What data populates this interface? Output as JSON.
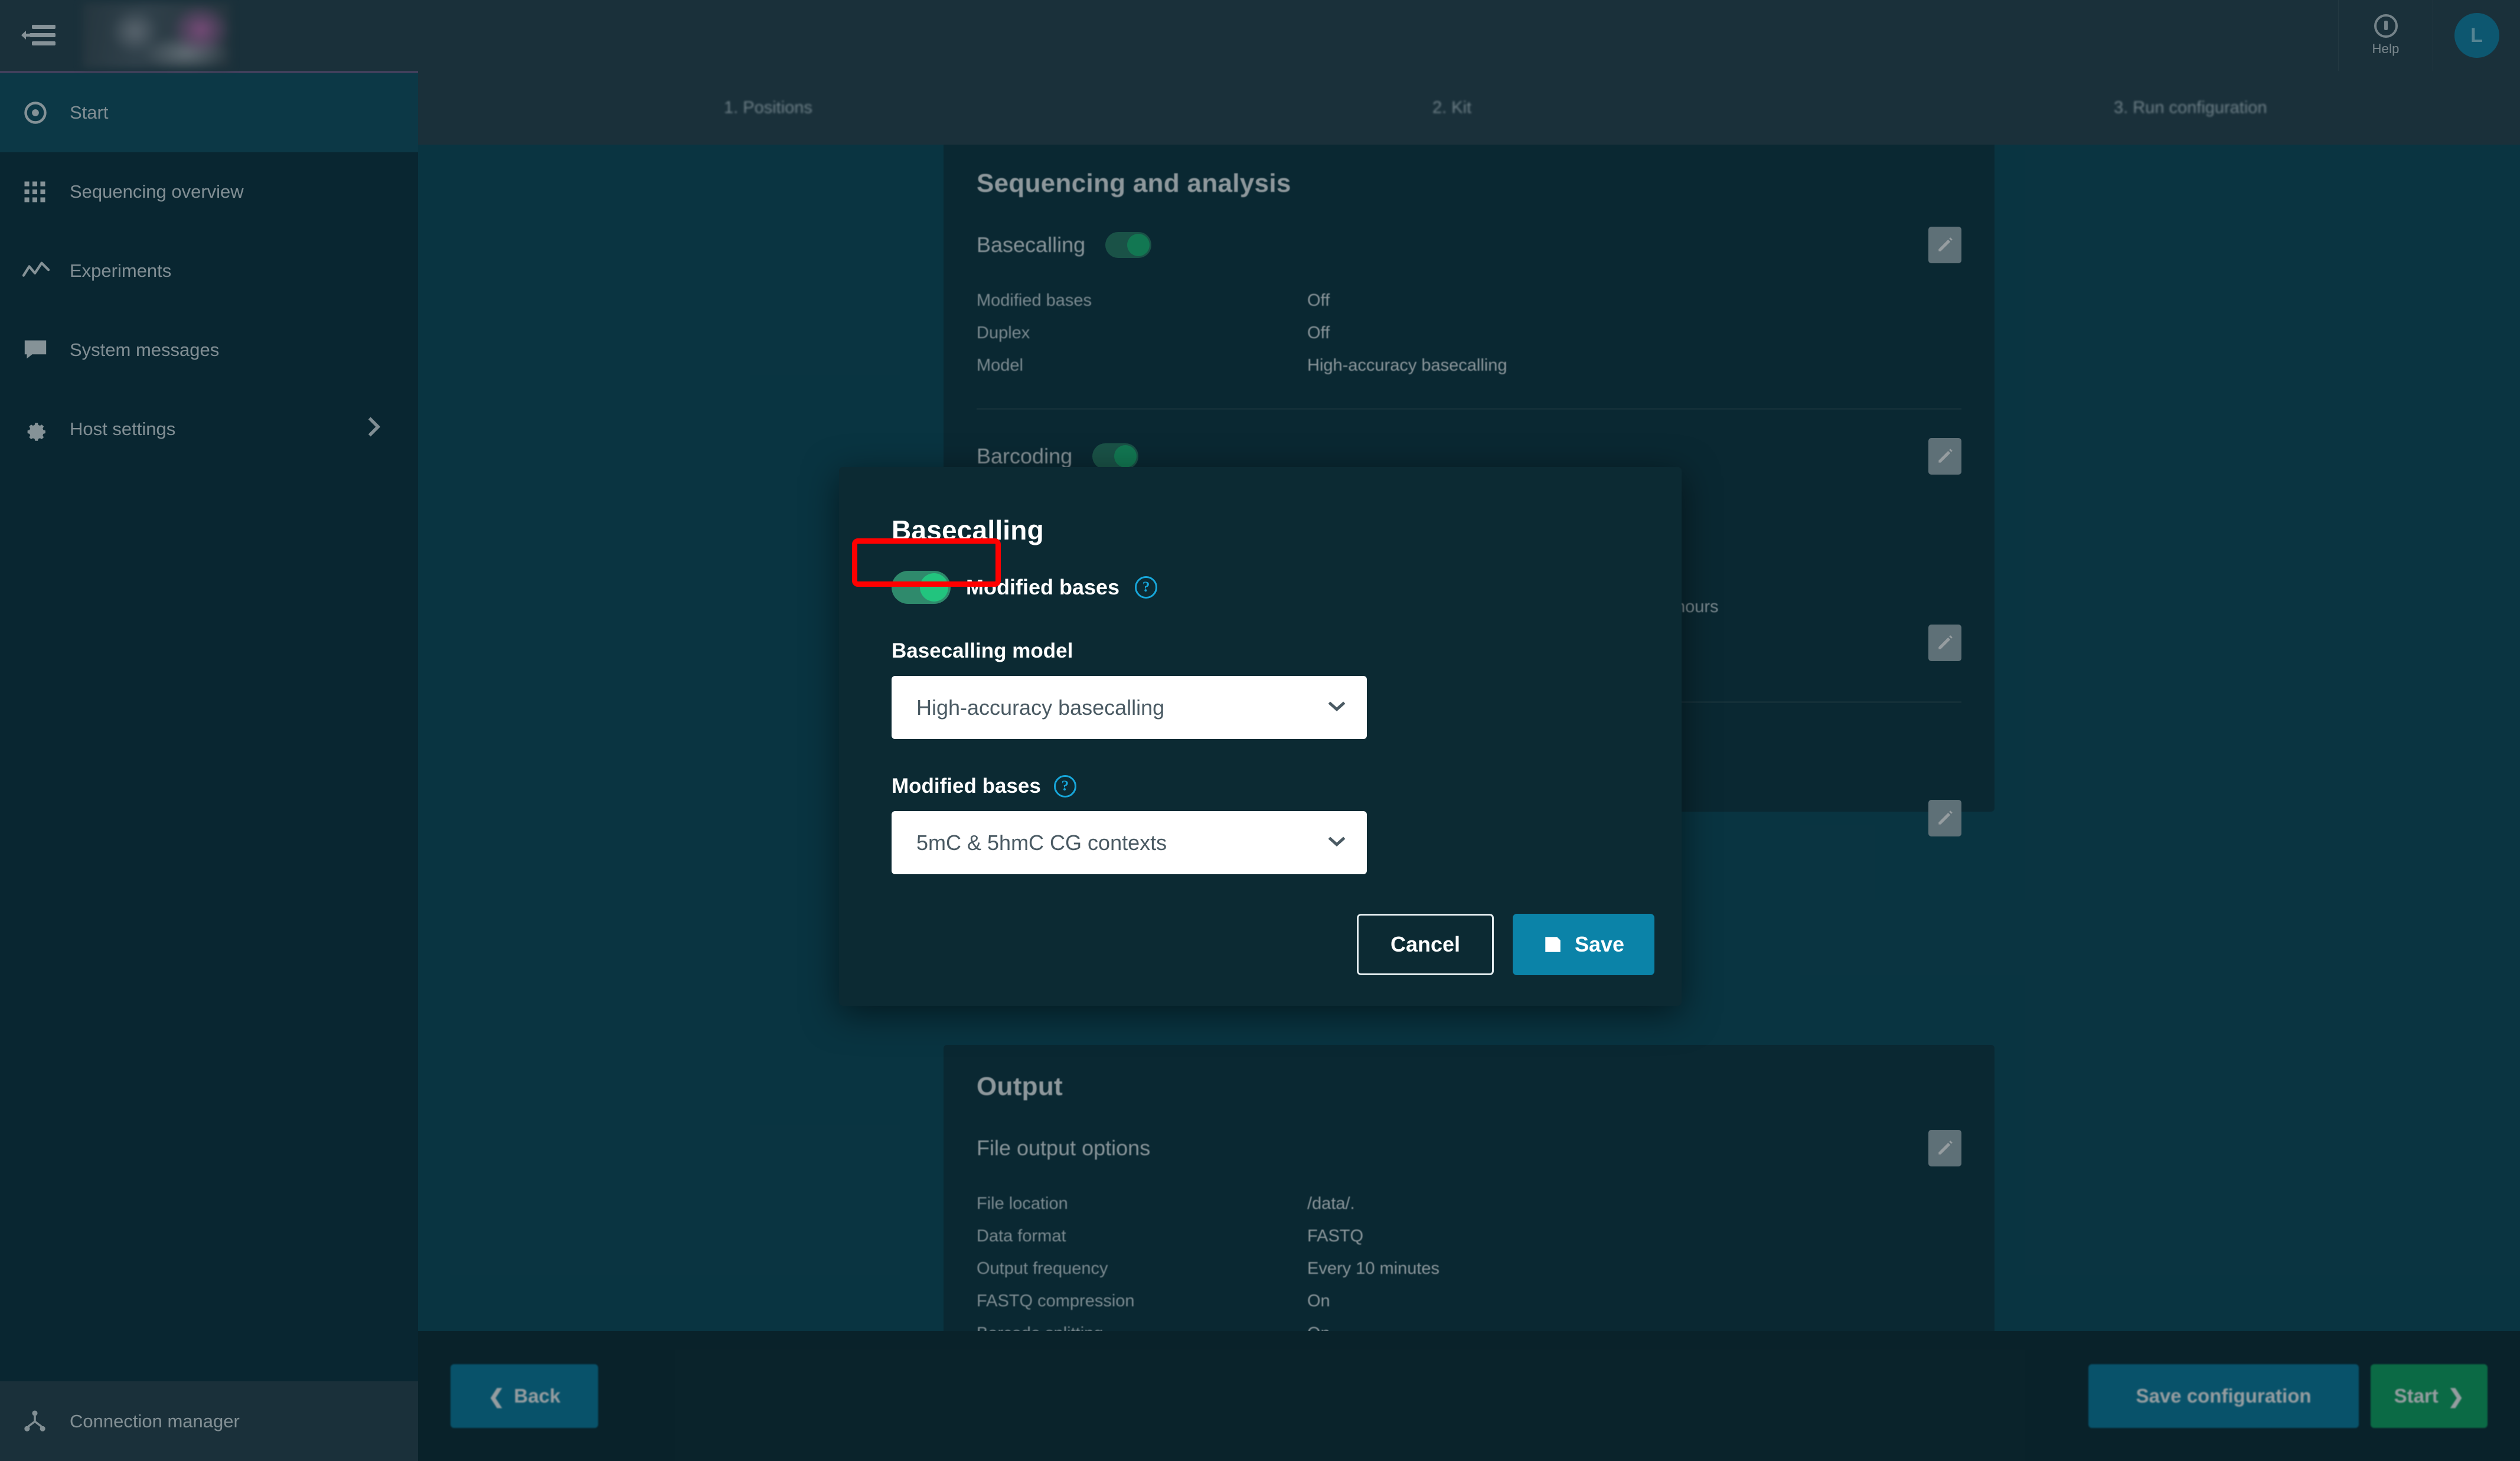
{
  "topbar": {
    "collapse_icon": "collapse-menu-icon",
    "logo_alt": "blurred-product-logo",
    "help_label": "Help",
    "help_icon": "help-circle-icon",
    "avatar_initial": "L"
  },
  "sidebar": {
    "items": [
      {
        "label": "Start",
        "icon": "target-icon",
        "active": true
      },
      {
        "label": "Sequencing overview",
        "icon": "grid-icon",
        "active": false
      },
      {
        "label": "Experiments",
        "icon": "activity-line-icon",
        "active": false
      },
      {
        "label": "System messages",
        "icon": "message-icon",
        "active": false
      },
      {
        "label": "Host settings",
        "icon": "gear-icon",
        "active": false,
        "has_chevron": true
      }
    ],
    "footer": {
      "label": "Connection manager",
      "icon": "network-node-icon"
    }
  },
  "steps": [
    {
      "label": "1. Positions"
    },
    {
      "label": "2. Kit"
    },
    {
      "label": "3. Run configuration"
    }
  ],
  "main": {
    "sequencing_panel": {
      "title": "Sequencing and analysis",
      "basecalling": {
        "label": "Basecalling",
        "toggle_on": true,
        "rows": [
          {
            "key": "Modified bases",
            "value": "Off"
          },
          {
            "key": "Duplex",
            "value": "Off"
          },
          {
            "key": "Model",
            "value": "High-accuracy basecalling"
          }
        ]
      },
      "barcoding": {
        "label": "Barcoding",
        "toggle_on": true
      },
      "hours_note": "hours"
    },
    "output_panel": {
      "title": "Output",
      "subtitle": "File output options",
      "rows": [
        {
          "key": "File location",
          "value": "/data/."
        },
        {
          "key": "Data format",
          "value": "FASTQ"
        },
        {
          "key": "Output frequency",
          "value": "Every 10 minutes"
        },
        {
          "key": "FASTQ compression",
          "value": "On"
        },
        {
          "key": "Barcode splitting",
          "value": "On"
        }
      ]
    }
  },
  "modal": {
    "title": "Basecalling",
    "modified_bases_toggle": {
      "label": "Modified bases",
      "on": true,
      "help_icon": "question-mark-icon",
      "highlighted": true
    },
    "basecalling_model": {
      "label": "Basecalling model",
      "value": "High-accuracy basecalling",
      "caret_icon": "chevron-down-icon"
    },
    "modified_bases_select": {
      "label": "Modified bases",
      "help_icon": "question-mark-icon",
      "value": "5mC & 5hmC CG contexts",
      "caret_icon": "chevron-down-icon"
    },
    "cancel_label": "Cancel",
    "save_label": "Save",
    "save_icon": "floppy-disk-icon"
  },
  "bottombar": {
    "back_label": "Back",
    "save_configuration_label": "Save configuration",
    "start_label": "Start"
  },
  "colors": {
    "page_bg": "#0d2c35",
    "topbar": "#2a4450",
    "sidebar": "#0d3340",
    "sidebar_active": "#125265",
    "content_bg": "#0d4a5c",
    "panel_bg": "#0f3642",
    "modal_bg": "#0c2a33",
    "accent_blue": "#0b83a8",
    "accent_green": "#10a763",
    "toggle_on": "#22c47e",
    "highlight_red": "#ff0000",
    "help_link": "#17a7db"
  }
}
